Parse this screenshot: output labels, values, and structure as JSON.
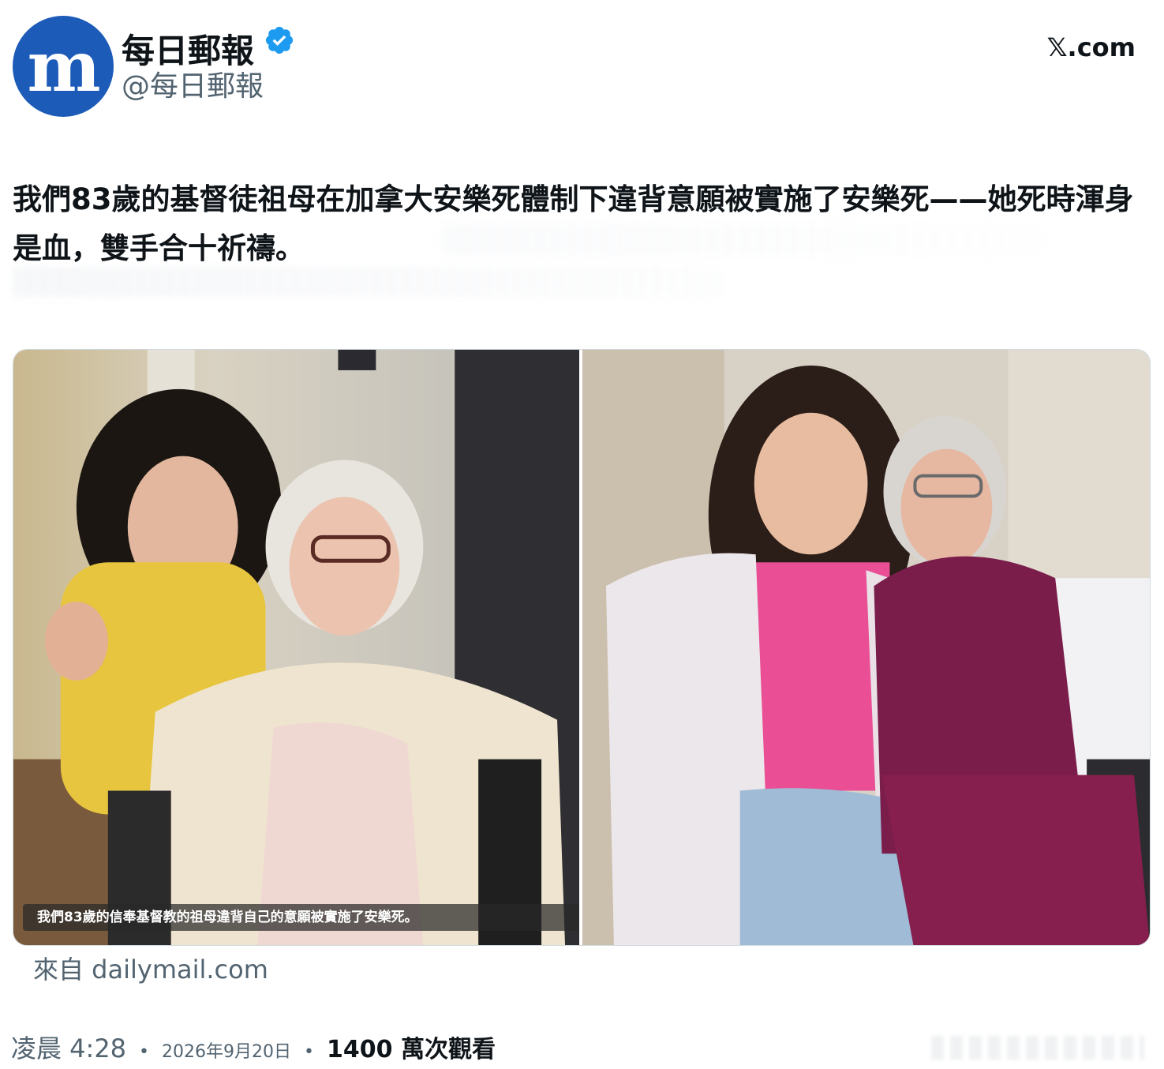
{
  "header": {
    "avatar_icon": "daily-mail-logo-icon",
    "display_name": "每日郵報",
    "verified_icon": "verified-badge-icon",
    "verified_color": "#1d9bf0",
    "handle": "@每日郵報",
    "site": ".com",
    "site_logo": "𝕏"
  },
  "tweet": {
    "text": "我們83歲的基督徒祖母在加拿大安樂死體制下違背意願被實施了安樂死——她死時渾身是血，雙手合十祈禱。"
  },
  "media": {
    "left_image": "woman-and-elderly-woman-in-wheelchair-photo",
    "right_image": "woman-and-elderly-woman-sitting-on-bed-photo",
    "caption": "我們83歲的信奉基督教的祖母違背自己的意願被實施了安樂死。"
  },
  "source": {
    "label": "來自 dailymail.com"
  },
  "meta": {
    "time": "凌晨 4:28",
    "date": "2026年9月20日",
    "views": "1400 萬次觀看"
  }
}
